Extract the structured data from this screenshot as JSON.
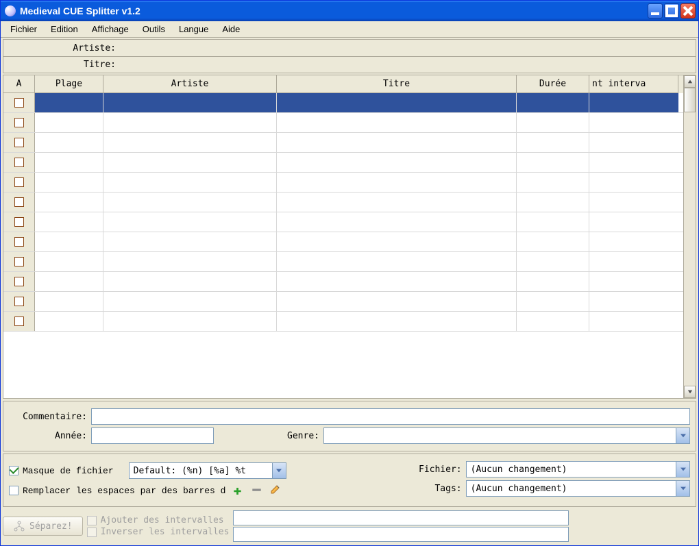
{
  "window": {
    "title": "Medieval CUE Splitter v1.2"
  },
  "menu": {
    "items": [
      "Fichier",
      "Edition",
      "Affichage",
      "Outils",
      "Langue",
      "Aide"
    ]
  },
  "info": {
    "artist_label": "Artiste:",
    "artist_value": "",
    "title_label": "Titre:",
    "title_value": ""
  },
  "table": {
    "cols": {
      "a": "A",
      "plage": "Plage",
      "artiste": "Artiste",
      "titre": "Titre",
      "duree": "Durée",
      "interv": "nt interva"
    },
    "rows": [
      {
        "checked": false,
        "sel": true,
        "plage": "",
        "artiste": "",
        "titre": "",
        "duree": "",
        "interv": ""
      },
      {
        "checked": false,
        "sel": false,
        "plage": "",
        "artiste": "",
        "titre": "",
        "duree": "",
        "interv": ""
      },
      {
        "checked": false,
        "sel": false,
        "plage": "",
        "artiste": "",
        "titre": "",
        "duree": "",
        "interv": ""
      },
      {
        "checked": false,
        "sel": false,
        "plage": "",
        "artiste": "",
        "titre": "",
        "duree": "",
        "interv": ""
      },
      {
        "checked": false,
        "sel": false,
        "plage": "",
        "artiste": "",
        "titre": "",
        "duree": "",
        "interv": ""
      },
      {
        "checked": false,
        "sel": false,
        "plage": "",
        "artiste": "",
        "titre": "",
        "duree": "",
        "interv": ""
      },
      {
        "checked": false,
        "sel": false,
        "plage": "",
        "artiste": "",
        "titre": "",
        "duree": "",
        "interv": ""
      },
      {
        "checked": false,
        "sel": false,
        "plage": "",
        "artiste": "",
        "titre": "",
        "duree": "",
        "interv": ""
      },
      {
        "checked": false,
        "sel": false,
        "plage": "",
        "artiste": "",
        "titre": "",
        "duree": "",
        "interv": ""
      },
      {
        "checked": false,
        "sel": false,
        "plage": "",
        "artiste": "",
        "titre": "",
        "duree": "",
        "interv": ""
      },
      {
        "checked": false,
        "sel": false,
        "plage": "",
        "artiste": "",
        "titre": "",
        "duree": "",
        "interv": ""
      },
      {
        "checked": false,
        "sel": false,
        "plage": "",
        "artiste": "",
        "titre": "",
        "duree": "",
        "interv": ""
      }
    ]
  },
  "meta": {
    "comment_label": "Commentaire:",
    "comment_value": "",
    "year_label": "Année:",
    "year_value": "",
    "genre_label": "Genre:",
    "genre_value": ""
  },
  "masks": {
    "filemask_label": "Masque de fichier",
    "filemask_checked": true,
    "filemask_value": "Default: (%n) [%a] %t",
    "replace_label": "Remplacer les espaces par des barres d",
    "replace_checked": false,
    "fichier_label": "Fichier:",
    "fichier_value": "(Aucun changement)",
    "tags_label": "Tags:",
    "tags_value": "(Aucun changement)"
  },
  "bottom": {
    "split_label": "Séparez!",
    "add_intervals_label": "Ajouter des intervalles",
    "invert_intervals_label": "Inverser les intervalles"
  }
}
